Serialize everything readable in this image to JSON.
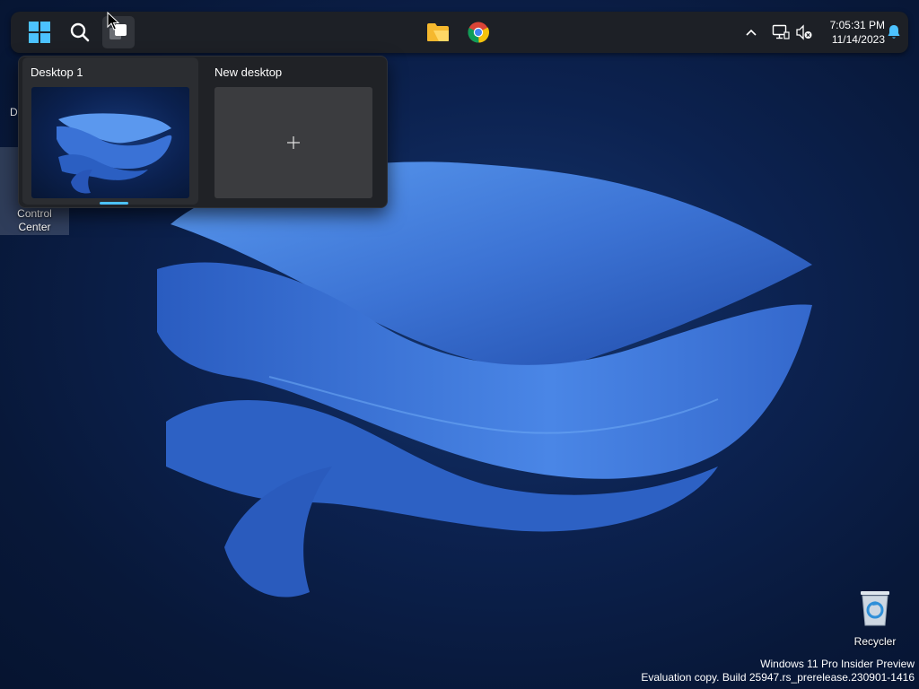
{
  "taskbar": {
    "start": {
      "icon": "windows-logo-icon"
    },
    "search": {
      "icon": "search-icon"
    },
    "task_view": {
      "icon": "task-view-icon",
      "active": true
    },
    "pinned": [
      {
        "name": "File Explorer",
        "icon": "folder-icon"
      },
      {
        "name": "Google Chrome",
        "icon": "chrome-icon"
      }
    ],
    "tray": {
      "overflow_icon": "chevron-up-icon",
      "network_icon": "network-icon",
      "volume_icon": "volume-muted-icon",
      "time": "7:05:31 PM",
      "date": "11/14/2023",
      "notification_icon": "bell-icon"
    }
  },
  "task_view": {
    "desktops": [
      {
        "label": "Desktop 1",
        "current": true
      },
      {
        "label": "New desktop",
        "icon": "plus-icon"
      }
    ]
  },
  "desktop": {
    "partial_label": "D",
    "icons": [
      {
        "label_line1": "Control",
        "label_line2": "Center"
      },
      {
        "label": "Recycler",
        "icon": "recycle-bin-icon"
      }
    ]
  },
  "watermark": {
    "line1": "Windows 11 Pro Insider Preview",
    "line2": "Evaluation copy. Build 25947.rs_prerelease.230901-1416"
  },
  "colors": {
    "accent": "#4cc2ff",
    "bloom": "#3f78d8",
    "taskbar": "#1d2026",
    "background": "#0c2250"
  }
}
